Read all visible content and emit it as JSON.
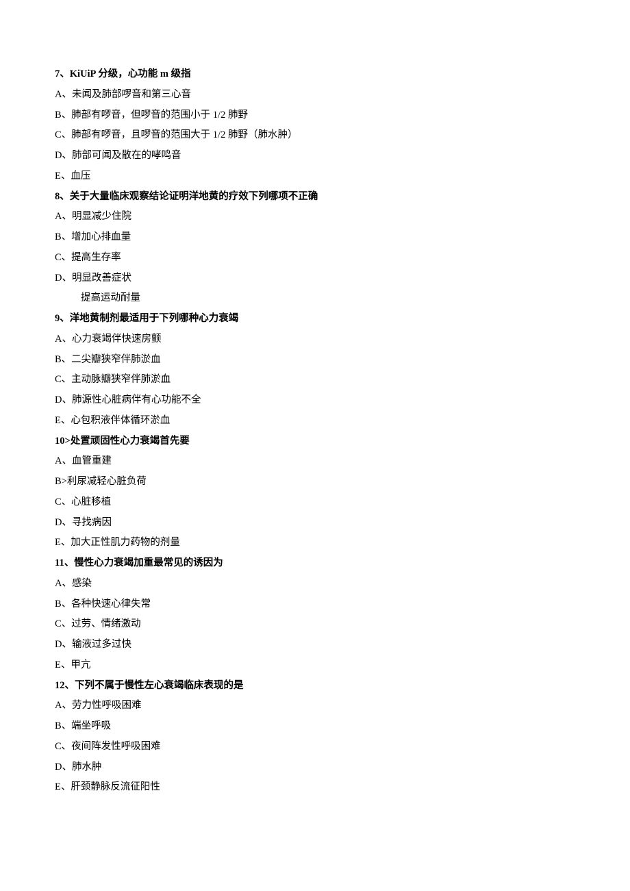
{
  "questions": [
    {
      "title": "7、KiUiP 分级，心功能 m 级指",
      "options": [
        "A、未闻及肺部啰音和第三心音",
        "B、肺部有啰音，但啰音的范围小于 1/2 肺野",
        "C、肺部有啰音，且啰音的范围大于 1/2 肺野（肺水肿）",
        "D、肺部可闻及散在的哮鸣音",
        "E、血压"
      ]
    },
    {
      "title": "8、关于大量临床观察结论证明洋地黄的疗效下列哪项不正确",
      "options": [
        "A、明显减少住院",
        "B、增加心排血量",
        "C、提高生存率",
        "D、明显改善症状"
      ],
      "subOptions": [
        "提高运动耐量"
      ]
    },
    {
      "title": "9、洋地黄制剂最适用于下列哪种心力衰竭",
      "options": [
        "A、心力衰竭伴快速房颤",
        "B、二尖瓣狭窄伴肺淤血",
        "C、主动脉瓣狭窄伴肺淤血",
        "D、肺源性心脏病伴有心功能不全",
        "E、心包积液伴体循环淤血"
      ]
    },
    {
      "title": "10>处置顽固性心力衰竭首先要",
      "options": [
        "A、血管重建",
        "B>利尿减轻心脏负荷",
        "C、心脏移植",
        "D、寻找病因",
        "E、加大正性肌力药物的剂量"
      ]
    },
    {
      "title": "11、慢性心力衰竭加重最常见的诱因为",
      "options": [
        "A、感染",
        "B、各种快速心律失常",
        "C、过劳、情绪激动",
        "D、输液过多过快",
        "E、甲亢"
      ]
    },
    {
      "title": "12、下列不属于慢性左心衰竭临床表现的是",
      "options": [
        "A、劳力性呼吸困难",
        "B、端坐呼吸",
        "C、夜间阵发性呼吸困难",
        "D、肺水肿",
        "E、肝颈静脉反流征阳性"
      ]
    }
  ]
}
